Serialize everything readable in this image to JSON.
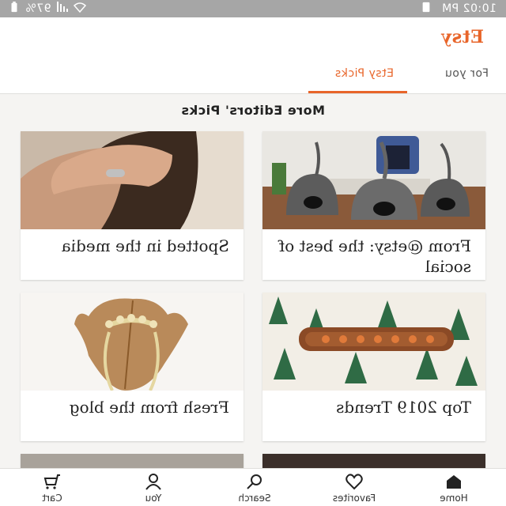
{
  "status_bar": {
    "time": "10:02 PM",
    "battery": "97%"
  },
  "header": {
    "logo": "Etsy"
  },
  "tabs": [
    {
      "label": "For you",
      "active": false
    },
    {
      "label": "Etsy Picks",
      "active": true
    }
  ],
  "section_title": "More Editors' Picks",
  "cards": [
    {
      "label": "From @etsy: the best of social",
      "image": "felt-cat-cave-photo"
    },
    {
      "label": "Spotted in the media",
      "image": "woman-with-ring-photo"
    },
    {
      "label": "Top 2019 Trends",
      "image": "wooden-tray-photo"
    },
    {
      "label": "Fresh from the blog",
      "image": "leaf-hair-pin-photo"
    }
  ],
  "bottom_nav": [
    {
      "label": "Home",
      "icon": "home-icon",
      "active": true
    },
    {
      "label": "Favorites",
      "icon": "heart-icon",
      "active": false
    },
    {
      "label": "Search",
      "icon": "search-icon",
      "active": false
    },
    {
      "label": "You",
      "icon": "person-icon",
      "active": false
    },
    {
      "label": "Cart",
      "icon": "cart-icon",
      "active": false
    }
  ],
  "colors": {
    "accent": "#e8652a",
    "status_bar": "#a6a6a6"
  }
}
